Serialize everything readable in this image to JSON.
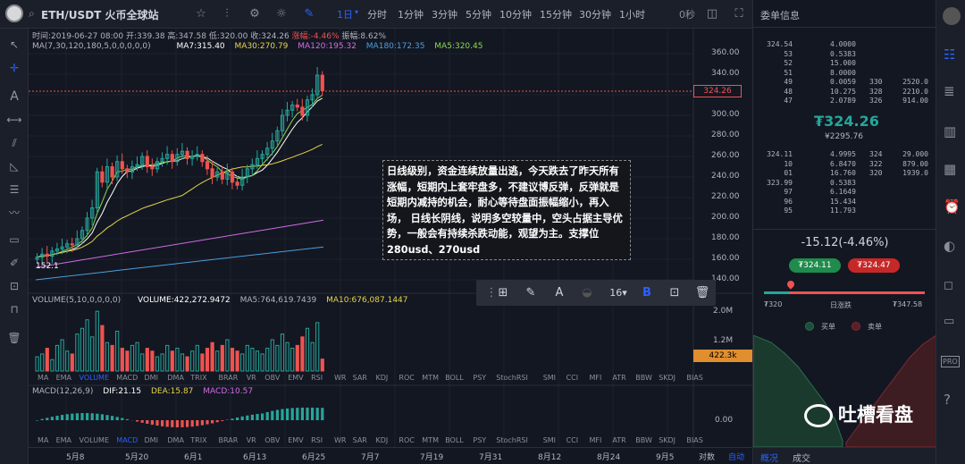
{
  "topbar": {
    "symbol": "ETH/USDT 火币全球站",
    "timeframes": [
      "1日",
      "分时",
      "1分钟",
      "3分钟",
      "5分钟",
      "10分钟",
      "15分钟",
      "30分钟",
      "1小时"
    ],
    "countdown": "0秒"
  },
  "ohlc_line": {
    "time": "时间:2019-06-27 08:00",
    "open": "开:339.38",
    "high": "高:347.58",
    "low": "低:320.00",
    "close": "收:324.26",
    "change": "涨幅:-4.46%",
    "amplitude": "振幅:8.62%"
  },
  "ma_line": {
    "label": "MA(7,30,120,180,5,0,0,0,0,0)",
    "ma7": "MA7:315.40",
    "ma30": "MA30:270.79",
    "ma120": "MA120:195.32",
    "ma180": "MA180:172.35",
    "ma5": "MA5:320.45"
  },
  "colors": {
    "up": "#26a69a",
    "down": "#ef5350",
    "ma7": "#ffffff",
    "ma30": "#e6d44b",
    "ma120": "#d26ce5",
    "ma180": "#4a9fe0",
    "ma5": "#8bd84e",
    "accent": "#2962ff"
  },
  "price_axis": {
    "ticks": [
      "360.00",
      "340.00",
      "320.00",
      "300.00",
      "280.00",
      "260.00",
      "240.00",
      "220.00",
      "200.00",
      "180.00",
      "160.00",
      "140.00"
    ],
    "current": "324.26"
  },
  "low_marker": "152.1",
  "note": "日线级别，资金连续放量出逃，今天跌去了昨天所有涨幅，短期内上套牢盘多，不建议博反弹，反弹就是短期内减持的机会，耐心等待盘面振幅缩小，再入场， 日线长阴线，说明多空较量中，空头占据主导优势，一般会有持续杀跌动能，观望为主。支撑位280usd、270usd",
  "drawbar": {
    "font_size": "16"
  },
  "volume_line": {
    "label": "VOLUME(5,10,0,0,0,0)",
    "volume": "VOLUME:422,272.9472",
    "ma5": "MA5:764,619.7439",
    "ma10": "MA10:676,087.1447"
  },
  "volume_axis": {
    "ticks": [
      "2.0M",
      "1.2M"
    ],
    "current": "422.3k"
  },
  "indicators": [
    "MA",
    "EMA",
    "VOLUME",
    "MACD",
    "DMI",
    "DMA",
    "TRIX",
    "BRAR",
    "VR",
    "OBV",
    "EMV",
    "RSI",
    "WR",
    "SAR",
    "KDJ",
    "ROC",
    "MTM",
    "BOLL",
    "PSY",
    "StochRSI",
    "SMI",
    "CCI",
    "MFI",
    "ATR",
    "BBW",
    "SKDJ",
    "BIAS"
  ],
  "macd_line": {
    "label": "MACD(12,26,9)",
    "dif": "DIF:21.15",
    "dea": "DEA:15.87",
    "macd": "MACD:10.57"
  },
  "macd_axis": {
    "tick": "0.00"
  },
  "date_axis": [
    "5月8",
    "5月20",
    "6月1",
    "6月13",
    "6月25",
    "7月7",
    "7月19",
    "7月31",
    "8月12",
    "8月24",
    "9月5"
  ],
  "axis_modes": [
    "对数",
    "自动"
  ],
  "orderbook": {
    "title": "委单信息",
    "asks": [
      [
        "324.54",
        "4.0000",
        "",
        ""
      ],
      [
        "53",
        "0.5383",
        "",
        ""
      ],
      [
        "52",
        "15.000",
        "",
        ""
      ],
      [
        "51",
        "8.0000",
        "",
        ""
      ],
      [
        "49",
        "0.0059",
        "330",
        "2520.0"
      ],
      [
        "48",
        "10.275",
        "328",
        "2210.0"
      ],
      [
        "47",
        "2.0789",
        "326",
        "914.00"
      ]
    ],
    "last_price": "₮324.26",
    "last_price_sub": "¥2295.76",
    "bids": [
      [
        "324.11",
        "4.9995",
        "324",
        "29.000"
      ],
      [
        "10",
        "6.8470",
        "322",
        "879.00"
      ],
      [
        "01",
        "16.760",
        "320",
        "1939.0"
      ],
      [
        "323.99",
        "0.5383",
        "",
        ""
      ],
      [
        "97",
        "6.1649",
        "",
        ""
      ],
      [
        "96",
        "15.434",
        "",
        ""
      ],
      [
        "95",
        "11.793",
        "",
        ""
      ]
    ],
    "change": "-15.12(-4.46%)",
    "bid_btn": "₮324.11",
    "ask_btn": "₮324.47",
    "range_low": "₮320",
    "range_label": "日涨跌",
    "range_high": "₮347.58",
    "legend_buy": "买单",
    "legend_sell": "卖单",
    "tabs": [
      "概况",
      "成交"
    ]
  },
  "watermark": "吐槽看盘"
}
